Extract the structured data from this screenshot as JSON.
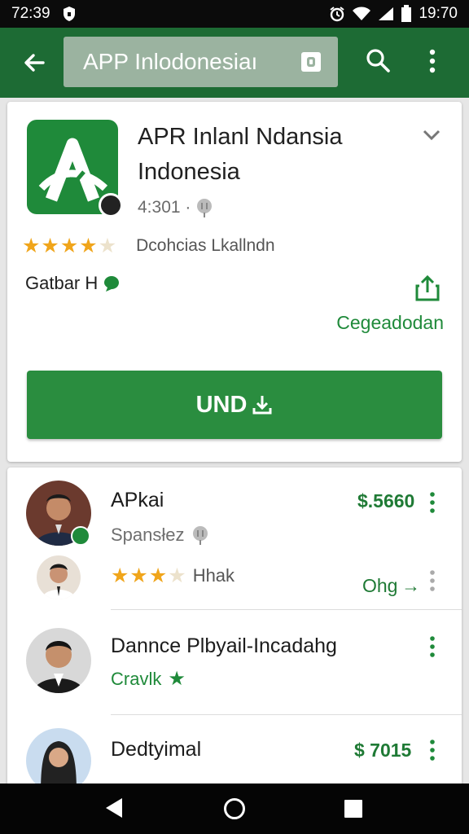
{
  "status_bar": {
    "time_left": "72:39",
    "time_right": "19:70",
    "icons": [
      "shield-icon",
      "alarm-icon",
      "wifi-icon",
      "signal-icon",
      "battery-icon"
    ]
  },
  "app_bar": {
    "back_icon": "arrow-left-icon",
    "search_text": "APP Inlodonesiaı",
    "search_badge_icon": "square-badge-icon",
    "search_icon": "search-icon",
    "more_icon": "more-vertical-icon"
  },
  "app_card": {
    "title_line1": "APR Inlanl Ndansia",
    "title_line2": "Indonesia",
    "meta": "4:301 ·",
    "rating": 4.5,
    "rating_label": "Dcohcias Lkallndn",
    "category": "Gatbar H",
    "share_label": "Cegeadodan",
    "install_label": "UND",
    "colors": {
      "accent": "#1f8a3a",
      "app_bar": "#1d6b34",
      "star": "#f0a51b"
    }
  },
  "list": [
    {
      "title": "APkai",
      "subtitle": "Spansłez",
      "price": "$.5660"
    },
    {
      "title": "",
      "subtitle": "Hhak",
      "price": "Ohg →",
      "stars": 3
    },
    {
      "title": "Dannce Plbyail-Incadahg",
      "subtitle": "Cravlk",
      "price": ""
    },
    {
      "title": "Dedtyimal",
      "subtitle": "",
      "price": "$ 7015"
    }
  ]
}
